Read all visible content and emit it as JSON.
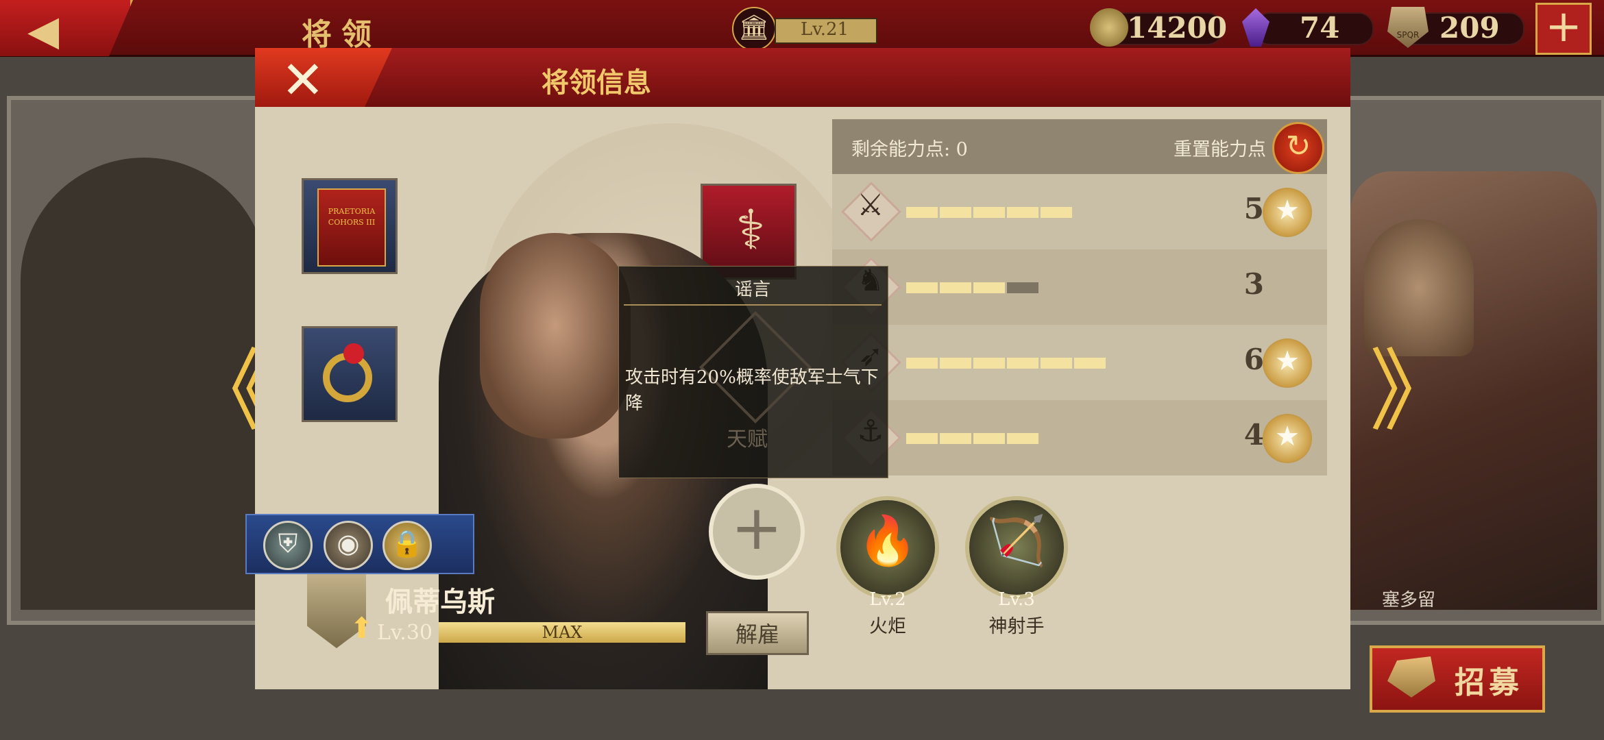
{
  "top_bar": {
    "title": "将领",
    "city_level": "Lv.21",
    "coins": "14200",
    "gems": "74",
    "spqr_tokens": "209",
    "spqr_icon_text": "SPQR"
  },
  "modal": {
    "title": "将领信息",
    "remaining_points_label": "剩余能力点: 0",
    "reset_points_label": "重置能力点",
    "stats": [
      {
        "icon": "sword-icon",
        "segments_filled": 5,
        "segments_total": 5,
        "value": "5",
        "has_badge": true
      },
      {
        "icon": "horse-icon",
        "segments_filled": 3,
        "segments_total": 4,
        "value": "3",
        "has_badge": false
      },
      {
        "icon": "crossbow-icon",
        "segments_filled": 6,
        "segments_total": 6,
        "value": "6",
        "has_badge": true
      },
      {
        "icon": "anchor-icon",
        "segments_filled": 4,
        "segments_total": 4,
        "value": "4",
        "has_badge": true
      }
    ],
    "tooltip": {
      "title": "谣言",
      "description": "攻击时有20%概率使敌军士气下降",
      "talent_label": "天赋"
    },
    "skills": [
      {
        "level": "Lv.2",
        "name": "火炬",
        "icon": "torch-icon"
      },
      {
        "level": "Lv.3",
        "name": "神射手",
        "icon": "archer-icon"
      }
    ],
    "hero": {
      "name": "佩蒂乌斯",
      "level": "Lv.30",
      "exp_text": "MAX",
      "dismiss_label": "解雇"
    },
    "item_slots": [
      {
        "name": "banner",
        "text": "PRAETORIA COHORS III"
      },
      {
        "name": "ring"
      },
      {
        "name": "caduceus"
      }
    ]
  },
  "side": {
    "right_hero_name": "塞多留",
    "recruit_label": "招募"
  },
  "colors": {
    "primary_red": "#7b1111",
    "gold": "#e4bf6d",
    "parchment": "#d8cdb5"
  }
}
